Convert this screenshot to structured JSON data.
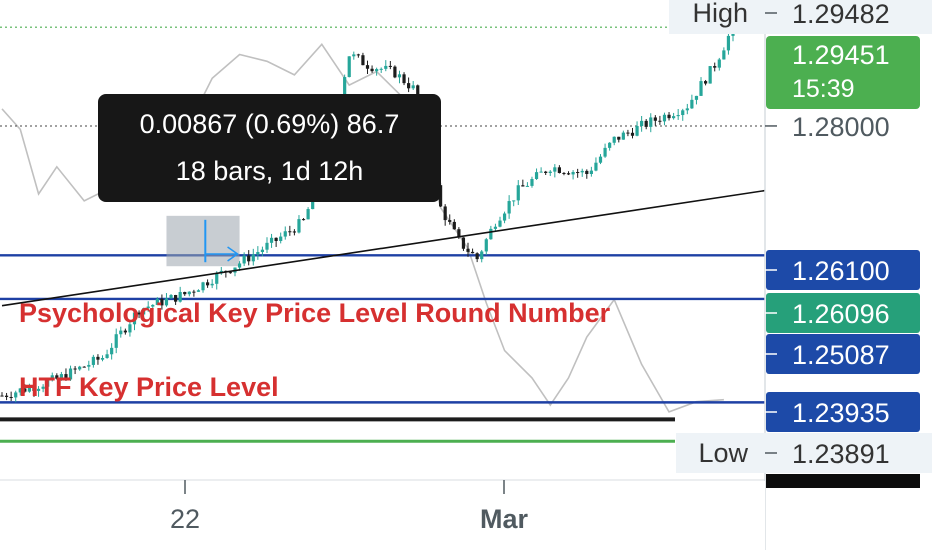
{
  "colors": {
    "up": "#26a69a",
    "down": "#1c1c1c",
    "level_line": "#1e40a4",
    "level_tag": "#1d4aa8",
    "current_tag": "#4caf50",
    "current_dotted": "#4caf50",
    "alt_tag": "#26a07a",
    "annotation_red": "#d63030",
    "shadow_series": "#c0c0c0",
    "trendline": "#111111",
    "measure_box": "#9aa4ad",
    "measure_arrow": "#2196f3",
    "tooltip_bg": "#171717",
    "axis_text": "#505a60",
    "info_box": "#eef3f7"
  },
  "chart_data": {
    "type": "candlestick",
    "x_ticks": [
      "22",
      "Mar"
    ],
    "y_axis": {
      "range": [
        1.228,
        1.2985
      ],
      "tick_labels": [
        "1.28000"
      ]
    },
    "info": {
      "high_label": "High",
      "high_value": "1.29482",
      "low_label": "Low",
      "low_value": "1.23891"
    },
    "current_price": {
      "value": "1.29451",
      "countdown": "15:39"
    },
    "price_tags": [
      {
        "value": "1.26100",
        "y": 1.261,
        "style": "level"
      },
      {
        "value": "1.26096",
        "y": 1.2573,
        "style": "alt"
      },
      {
        "value": "1.25087",
        "y": 1.2515,
        "style": "level"
      },
      {
        "value": "1.23935",
        "y": 1.2394,
        "style": "level"
      }
    ],
    "horizontal_levels": [
      {
        "y": 1.261,
        "color": "level_line",
        "name": "level-126100"
      },
      {
        "y": 1.2546,
        "color": "level_line",
        "name": "level-125460"
      },
      {
        "y": 1.2394,
        "color": "level_line",
        "name": "level-123935"
      },
      {
        "y": 1.2369,
        "color": "down",
        "name": "level-black"
      },
      {
        "y": 1.2337,
        "color": "current_tag",
        "name": "level-green"
      }
    ],
    "annotations": [
      {
        "text": "Psychological Key Price Level Round Number",
        "name": "annotation-psychological"
      },
      {
        "text": "HTF Key Price Level",
        "name": "annotation-htf"
      }
    ],
    "tooltip": {
      "line1": "0.00867 (0.69%) 86.7",
      "line2": "18 bars, 1d 12h"
    },
    "trendline": {
      "start": [
        0,
        1.2536
      ],
      "end": [
        160,
        1.2698
      ]
    },
    "candle_anchors": [
      [
        0,
        1.2404
      ],
      [
        12,
        1.2428
      ],
      [
        22,
        1.246
      ],
      [
        30,
        1.2531
      ],
      [
        40,
        1.2553
      ],
      [
        52,
        1.2599
      ],
      [
        60,
        1.2632
      ],
      [
        66,
        1.266
      ],
      [
        70,
        1.273
      ],
      [
        76,
        1.2905
      ],
      [
        80,
        1.289
      ],
      [
        86,
        1.2878
      ],
      [
        90,
        1.2855
      ],
      [
        96,
        1.268
      ],
      [
        100,
        1.263
      ],
      [
        104,
        1.2605
      ],
      [
        108,
        1.266
      ],
      [
        113,
        1.2705
      ],
      [
        120,
        1.274
      ],
      [
        128,
        1.273
      ],
      [
        134,
        1.278
      ],
      [
        140,
        1.28
      ],
      [
        150,
        1.283
      ],
      [
        156,
        1.289
      ],
      [
        160,
        1.2945
      ]
    ],
    "shadow_series": [
      [
        0,
        1.2825
      ],
      [
        4,
        1.2795
      ],
      [
        8,
        1.27
      ],
      [
        12,
        1.274
      ],
      [
        18,
        1.269
      ],
      [
        24,
        1.271
      ],
      [
        30,
        1.276
      ],
      [
        40,
        1.279
      ],
      [
        46,
        1.287
      ],
      [
        52,
        1.2905
      ],
      [
        58,
        1.2895
      ],
      [
        64,
        1.2875
      ],
      [
        70,
        1.292
      ],
      [
        76,
        1.286
      ],
      [
        82,
        1.288
      ],
      [
        88,
        1.284
      ],
      [
        92,
        1.279
      ],
      [
        96,
        1.268
      ],
      [
        102,
        1.262
      ],
      [
        106,
        1.254
      ],
      [
        110,
        1.247
      ],
      [
        116,
        1.243
      ],
      [
        120,
        1.239
      ],
      [
        124,
        1.243
      ],
      [
        128,
        1.249
      ],
      [
        134,
        1.2545
      ],
      [
        140,
        1.245
      ],
      [
        146,
        1.238
      ],
      [
        152,
        1.2395
      ],
      [
        158,
        1.2398
      ]
    ]
  }
}
